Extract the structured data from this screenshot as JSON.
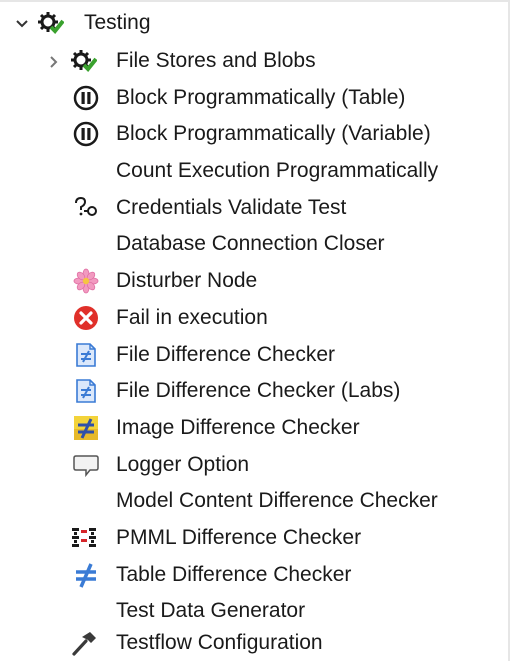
{
  "tree": {
    "root": {
      "label": "Testing",
      "icon": "gear-check-icon",
      "expanded": true
    },
    "children": [
      {
        "label": "File Stores and Blobs",
        "icon": "gear-check-icon",
        "collapsible": true
      },
      {
        "label": "Block Programmatically (Table)",
        "icon": "pause-circle-icon"
      },
      {
        "label": "Block Programmatically (Variable)",
        "icon": "pause-circle-icon"
      },
      {
        "label": "Count Execution Programmatically",
        "icon": ""
      },
      {
        "label": "Credentials Validate Test",
        "icon": "key-question-icon"
      },
      {
        "label": "Database Connection Closer",
        "icon": ""
      },
      {
        "label": "Disturber Node",
        "icon": "flower-icon"
      },
      {
        "label": "Fail in execution",
        "icon": "error-x-icon"
      },
      {
        "label": "File Difference Checker",
        "icon": "file-diff-icon"
      },
      {
        "label": "File Difference Checker (Labs)",
        "icon": "file-diff-icon"
      },
      {
        "label": "Image Difference Checker",
        "icon": "image-diff-icon"
      },
      {
        "label": "Logger Option",
        "icon": "speech-bubble-icon"
      },
      {
        "label": "Model Content Difference Checker",
        "icon": ""
      },
      {
        "label": "PMML Difference Checker",
        "icon": "pmml-diff-icon"
      },
      {
        "label": "Table Difference Checker",
        "icon": "not-equal-icon"
      },
      {
        "label": "Test Data Generator",
        "icon": ""
      },
      {
        "label": "Testflow Configuration",
        "icon": "hammer-icon"
      }
    ]
  },
  "colors": {
    "gear": "#1a1a1a",
    "check": "#3aa12e",
    "error": "#e0302a",
    "diff_blue": "#3a7bd5",
    "image_diff_yellow": "#f3d33a"
  }
}
